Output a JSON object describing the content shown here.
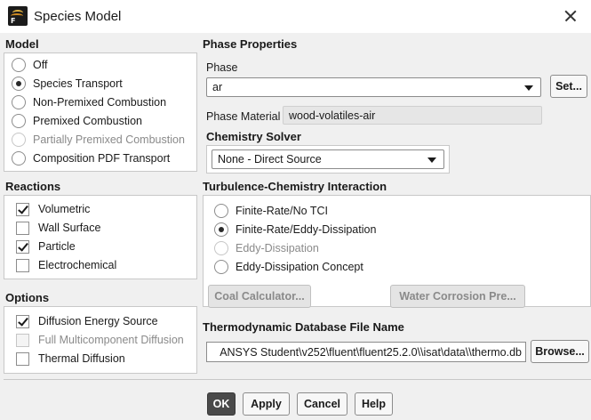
{
  "window": {
    "title": "Species Model",
    "app_icon_letter": "F"
  },
  "model": {
    "title": "Model",
    "options": [
      {
        "label": "Off",
        "checked": false,
        "disabled": false
      },
      {
        "label": "Species Transport",
        "checked": true,
        "disabled": false
      },
      {
        "label": "Non-Premixed Combustion",
        "checked": false,
        "disabled": false
      },
      {
        "label": "Premixed Combustion",
        "checked": false,
        "disabled": false
      },
      {
        "label": "Partially Premixed Combustion",
        "checked": false,
        "disabled": true
      },
      {
        "label": "Composition PDF Transport",
        "checked": false,
        "disabled": false
      }
    ]
  },
  "reactions": {
    "title": "Reactions",
    "items": [
      {
        "label": "Volumetric",
        "checked": true,
        "disabled": false
      },
      {
        "label": "Wall Surface",
        "checked": false,
        "disabled": false
      },
      {
        "label": "Particle",
        "checked": true,
        "disabled": false
      },
      {
        "label": "Electrochemical",
        "checked": false,
        "disabled": false
      }
    ]
  },
  "options": {
    "title": "Options",
    "items": [
      {
        "label": "Diffusion Energy Source",
        "checked": true,
        "disabled": false
      },
      {
        "label": "Full Multicomponent Diffusion",
        "checked": false,
        "disabled": true
      },
      {
        "label": "Thermal Diffusion",
        "checked": false,
        "disabled": false
      }
    ]
  },
  "phase_properties": {
    "title": "Phase Properties",
    "phase_label": "Phase",
    "phase_value": "ar",
    "set_button": "Set...",
    "phase_material_label": "Phase Material",
    "phase_material_value": "wood-volatiles-air",
    "chemistry_solver_title": "Chemistry Solver",
    "chemistry_solver_value": "None - Direct Source"
  },
  "tci": {
    "title": "Turbulence-Chemistry Interaction",
    "options": [
      {
        "label": "Finite-Rate/No TCI",
        "checked": false,
        "disabled": false
      },
      {
        "label": "Finite-Rate/Eddy-Dissipation",
        "checked": true,
        "disabled": false
      },
      {
        "label": "Eddy-Dissipation",
        "checked": false,
        "disabled": true
      },
      {
        "label": "Eddy-Dissipation Concept",
        "checked": false,
        "disabled": false
      }
    ],
    "coal_button": "Coal Calculator...",
    "water_button": "Water Corrosion Pre..."
  },
  "thermo": {
    "title": "Thermodynamic Database File Name",
    "value": "ANSYS Student\\v252\\fluent\\fluent25.2.0\\\\isat\\data\\\\thermo.db",
    "browse_button": "Browse..."
  },
  "footer": {
    "ok": "OK",
    "apply": "Apply",
    "cancel": "Cancel",
    "help": "Help"
  }
}
